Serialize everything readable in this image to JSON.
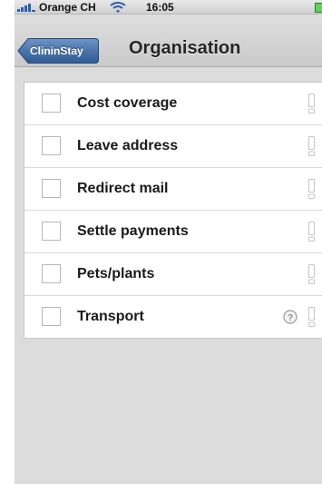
{
  "status_bar": {
    "carrier": "Orange CH",
    "time": "16:05",
    "signal_icon": "signal-bars-icon",
    "wifi_icon": "wifi-icon",
    "battery_icon": "battery-icon",
    "battery_color": "#5fd35a"
  },
  "nav_bar": {
    "back_label": "ClininStay",
    "title": "Organisation",
    "back_button_color": "#3f6aa0"
  },
  "list": {
    "items": [
      {
        "label": "Cost coverage",
        "checked": false,
        "has_help": false
      },
      {
        "label": "Leave address",
        "checked": false,
        "has_help": false
      },
      {
        "label": "Redirect mail",
        "checked": false,
        "has_help": false
      },
      {
        "label": "Settle payments",
        "checked": false,
        "has_help": false
      },
      {
        "label": "Pets/plants",
        "checked": false,
        "has_help": false
      },
      {
        "label": "Transport",
        "checked": false,
        "has_help": true
      }
    ],
    "help_icon": "question-circle-icon",
    "indicator_icon": "exclamation-indicator-icon"
  }
}
